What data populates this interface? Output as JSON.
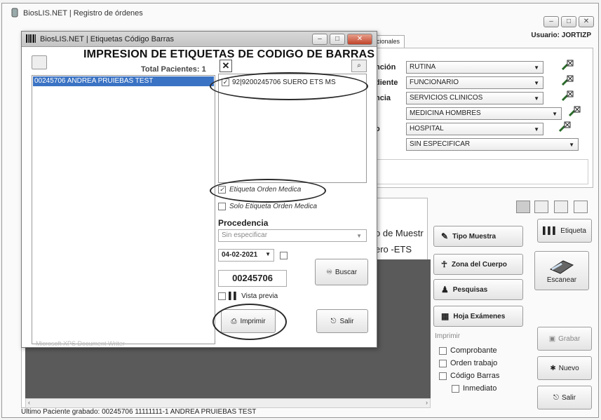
{
  "main_window": {
    "title": "BiosLIS.NET | Registro de órdenes",
    "user_label": "Usuario: JORTIZP",
    "tab_label": "icionales",
    "form": {
      "rows": [
        {
          "label": "nción",
          "value": "RUTINA"
        },
        {
          "label": "diente",
          "value": "FUNCIONARIO"
        },
        {
          "label": "ncia",
          "value": "SERVICIOS CLINICOS"
        },
        {
          "label": "",
          "value": "MEDICINA HOMBRES"
        },
        {
          "label": "o",
          "value": "HOSPITAL"
        },
        {
          "label": "",
          "value": "SIN ESPECIFICAR"
        }
      ]
    },
    "grid": {
      "header": "o de Muestr",
      "cell": "ero -ETS"
    },
    "side_buttons": {
      "tipo_muestra": "Tipo Muestra",
      "zona_cuerpo": "Zona del Cuerpo",
      "pesquisas": "Pesquisas",
      "hoja_examenes": "Hoja Exámenes"
    },
    "right_buttons": {
      "etiqueta": "Etiqueta",
      "escanear": "Escanear",
      "grabar": "Grabar",
      "nuevo": "Nuevo",
      "salir": "Salir"
    },
    "print_group": {
      "legend": "Imprimir",
      "options": [
        "Comprobante",
        "Orden trabajo",
        "Código Barras",
        "Inmediato"
      ]
    },
    "status_bar": "Ultimo Paciente grabado: 00245706 11111111-1 ANDREA PRUIEBAS TEST"
  },
  "dialog": {
    "title": "BiosLIS.NET | Etiquetas Código Barras",
    "heading": "IMPRESION DE ETIQUETAS DE CODIGO DE BARRAS",
    "total_patients": "Total Pacientes: 1",
    "patients": [
      "00245706 ANDREA PRUIEBAS TEST"
    ],
    "xps_label": "Microsoft XPS Document Writer",
    "labels": [
      {
        "checked": true,
        "text": "92|9200245706 SUERO ETS MS"
      }
    ],
    "etiqueta_orden_medica": "Etiqueta Orden Medica",
    "solo_etiqueta_orden_medica": "Solo Etiqueta Orden Medica",
    "procedencia_label": "Procedencia",
    "procedencia_value": "Sin especificar",
    "date": "04-02-2021",
    "patient_id": "00245706",
    "buscar": "Buscar",
    "vista_previa": "Vista previa",
    "imprimir": "Imprimir",
    "salir": "Salir"
  }
}
